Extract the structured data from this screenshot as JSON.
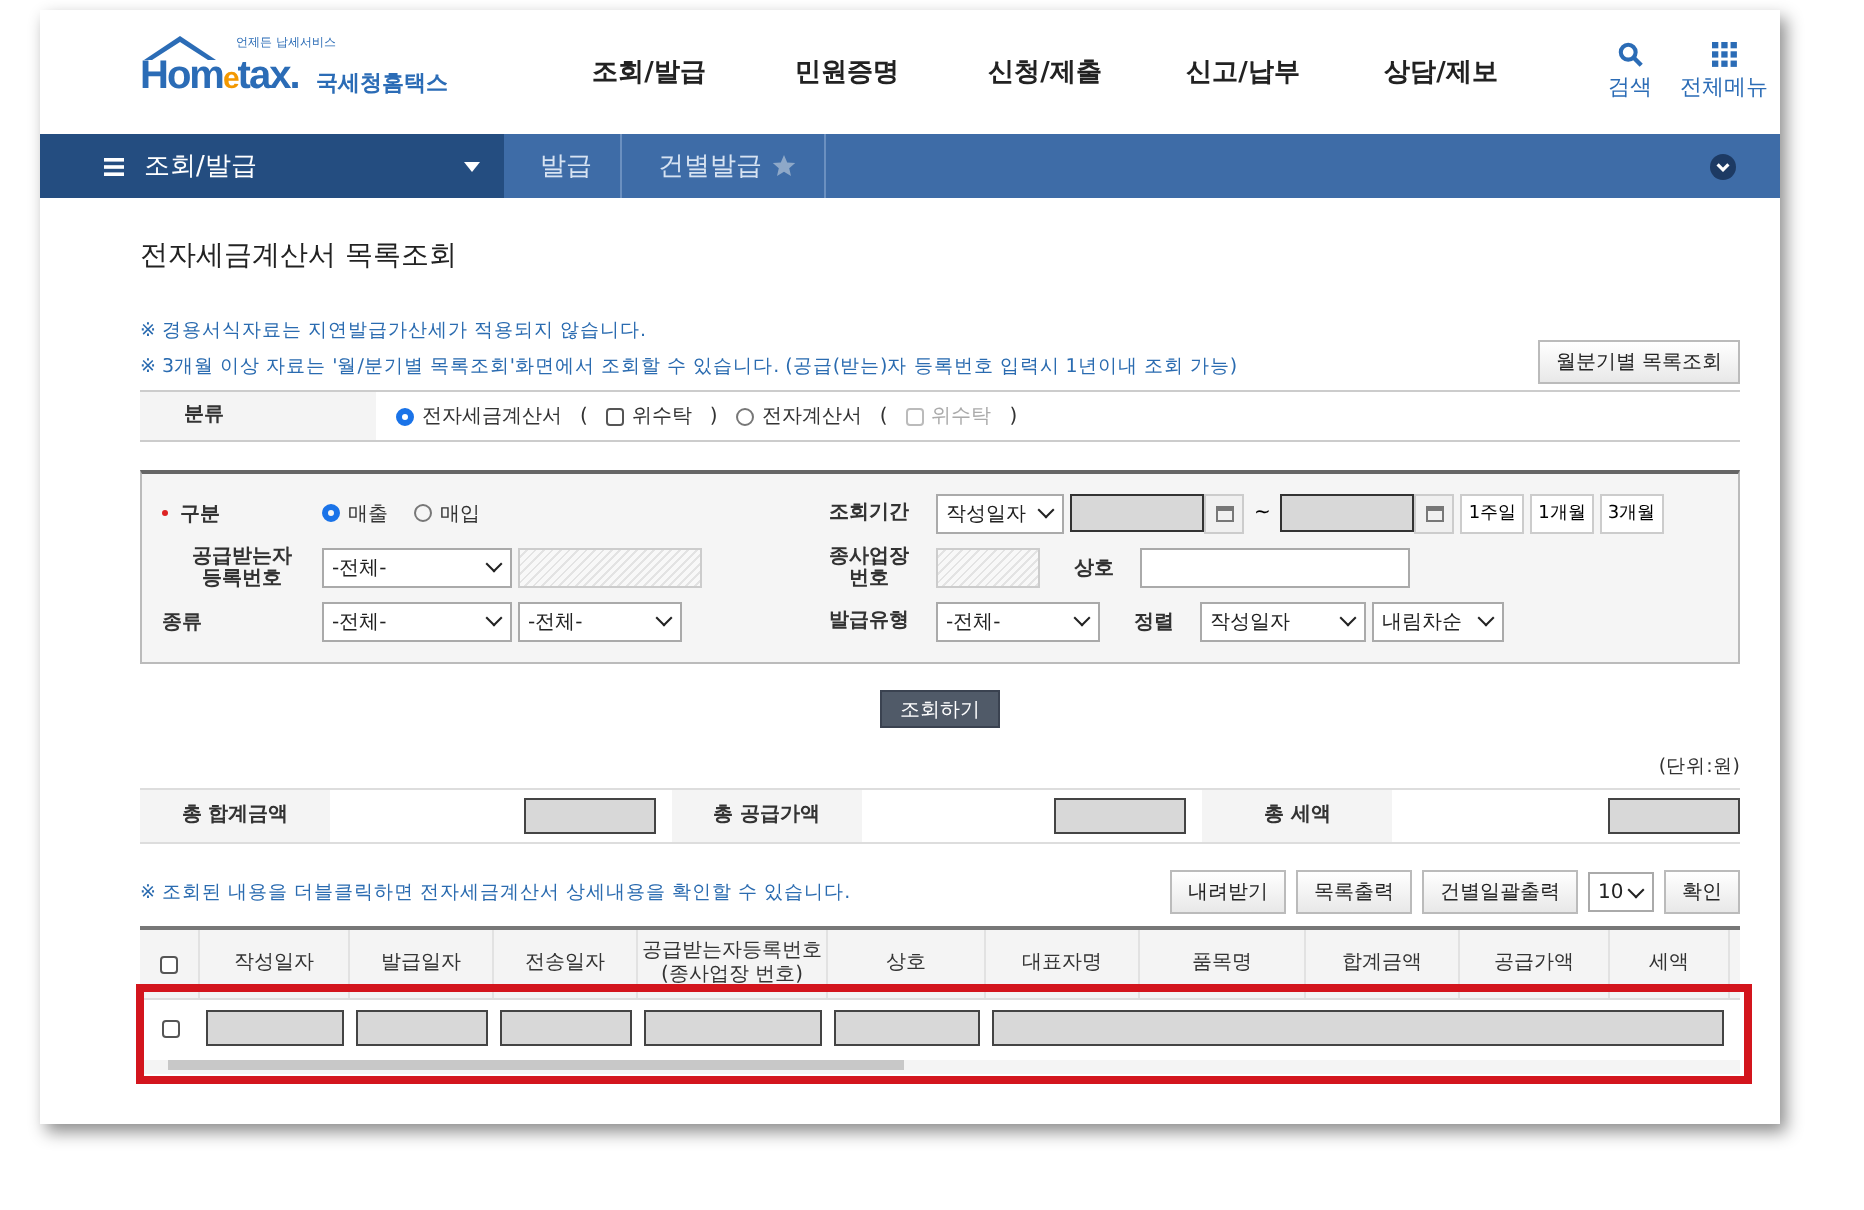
{
  "logo": {
    "tagline": "언제든 납세서비스",
    "brand_parts": [
      "Hom",
      "e",
      "tax."
    ],
    "name": "국세청홈택스"
  },
  "nav": [
    "조회/발급",
    "민원증명",
    "신청/제출",
    "신고/납부",
    "상담/제보"
  ],
  "tools": [
    {
      "kind": "search",
      "label": "검색"
    },
    {
      "kind": "menu",
      "label": "전체메뉴"
    }
  ],
  "breadcrumb": {
    "menu": "조회/발급",
    "items": [
      {
        "label": "발급"
      },
      {
        "label": "건별발급"
      }
    ],
    "starred": false
  },
  "page_title": "전자세금계산서 목록조회",
  "notes": [
    "※ 경용서식자료는 지연발급가산세가 적용되지 않습니다.",
    "※ 3개월 이상 자료는 '월/분기별 목록조회'화면에서 조회할 수 있습니다. (공급(받는)자 등록번호 입력시 1년이내 조회 가능)"
  ],
  "monthly_button": "월분기별 목록조회",
  "category": {
    "label": "분류",
    "brackets": [
      "(",
      ")"
    ],
    "options": [
      {
        "label": "전자세금계산서",
        "selected": true,
        "sub": {
          "label": "위수탁",
          "checked": false,
          "disabled": false
        }
      },
      {
        "label": "전자계산서",
        "selected": false,
        "sub": {
          "label": "위수탁",
          "checked": false,
          "disabled": true
        }
      }
    ]
  },
  "form": {
    "division": {
      "label": "구분",
      "required": true,
      "options": [
        {
          "label": "매출",
          "selected": true
        },
        {
          "label": "매입",
          "selected": false
        }
      ]
    },
    "period": {
      "label": "조회기간",
      "select": "작성일자",
      "separator": "~",
      "buttons": [
        "1주일",
        "1개월",
        "3개월"
      ]
    },
    "recipient": {
      "label_lines": [
        "공급받는자",
        "등록번호"
      ],
      "select": "-전체-"
    },
    "branch": {
      "label_lines": [
        "종사업장",
        "번호"
      ]
    },
    "company": {
      "label": "상호"
    },
    "type": {
      "label": "종류",
      "selects": [
        "-전체-",
        "-전체-"
      ]
    },
    "issue_type": {
      "label": "발급유형",
      "select": "-전체-"
    },
    "sort": {
      "label": "정렬",
      "selects": [
        "작성일자",
        "내림차순"
      ]
    }
  },
  "submit": "조회하기",
  "unit": "(단위:원)",
  "totals": [
    {
      "label": "총 합계금액"
    },
    {
      "label": "총 공급가액"
    },
    {
      "label": "총 세액"
    }
  ],
  "list_note": "※ 조회된 내용을 더블클릭하면 전자세금계산서 상세내용을 확인할 수 있습니다.",
  "actions": [
    "내려받기",
    "목록출력",
    "건별일괄출력"
  ],
  "page_size": "10",
  "confirm": "확인",
  "table": {
    "columns": [
      {
        "lines": [
          "작성일자"
        ]
      },
      {
        "lines": [
          "발급일자"
        ]
      },
      {
        "lines": [
          "전송일자"
        ]
      },
      {
        "lines": [
          "공급받는자등록번호",
          "(종사업장 번호)"
        ]
      },
      {
        "lines": [
          "상호"
        ]
      },
      {
        "lines": [
          "대표자명"
        ]
      },
      {
        "lines": [
          "품목명"
        ]
      },
      {
        "lines": [
          "합계금액"
        ]
      },
      {
        "lines": [
          "공급가액"
        ]
      },
      {
        "lines": [
          "세액"
        ]
      }
    ],
    "all_checked": false,
    "rows": [
      {
        "checked": false,
        "highlighted": true
      }
    ]
  }
}
